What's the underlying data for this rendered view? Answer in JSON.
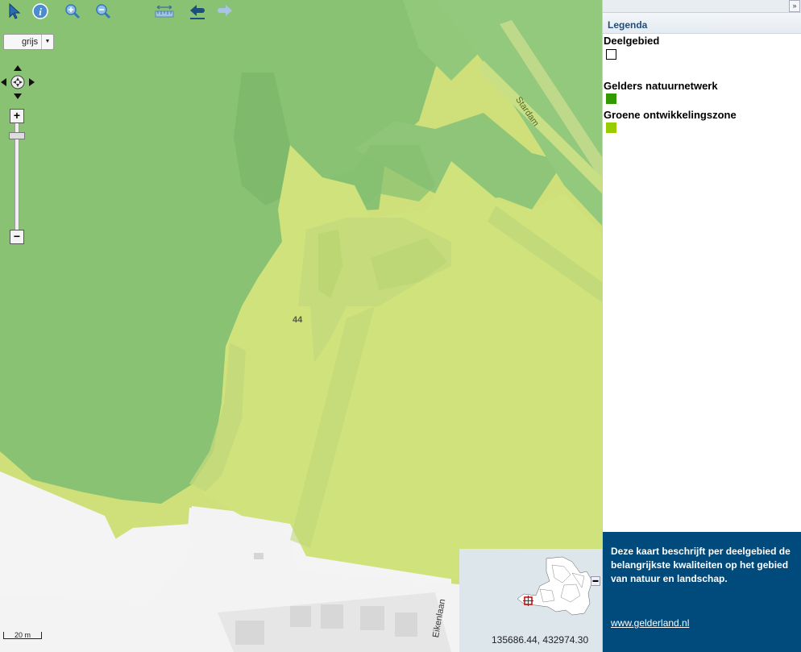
{
  "toolbar": {
    "tools": [
      "select-tool",
      "info-tool",
      "zoom-in-tool",
      "zoom-out-tool",
      "measure-tool",
      "previous-extent",
      "next-extent"
    ]
  },
  "map": {
    "basemap_label": "grijs",
    "parcel_number": "44",
    "road_labels": [
      "Stardam",
      "Eikenlaan"
    ],
    "scale_label": "20 m",
    "coordinates": "135686.44, 432974.30",
    "colors": {
      "natuurnetwerk_fill": "#8fc679",
      "ontwikkelingszone_fill": "#cfe07a",
      "built_area": "#f4f4f4",
      "building": "#dadada"
    }
  },
  "panel": {
    "legend_title": "Legenda",
    "items": [
      {
        "label": "Deelgebied",
        "color": "#ffffff",
        "border": "#000000"
      },
      {
        "label": "Gelders natuurnetwerk",
        "color": "#339900"
      },
      {
        "label": "Groene ontwikkelingszone",
        "color": "#99cc00"
      }
    ],
    "info_text": "Deze kaart beschrijft per deelgebied de belangrijkste kwaliteiten op het gebied van natuur en landschap.",
    "info_link": "www.gelderland.nl"
  }
}
